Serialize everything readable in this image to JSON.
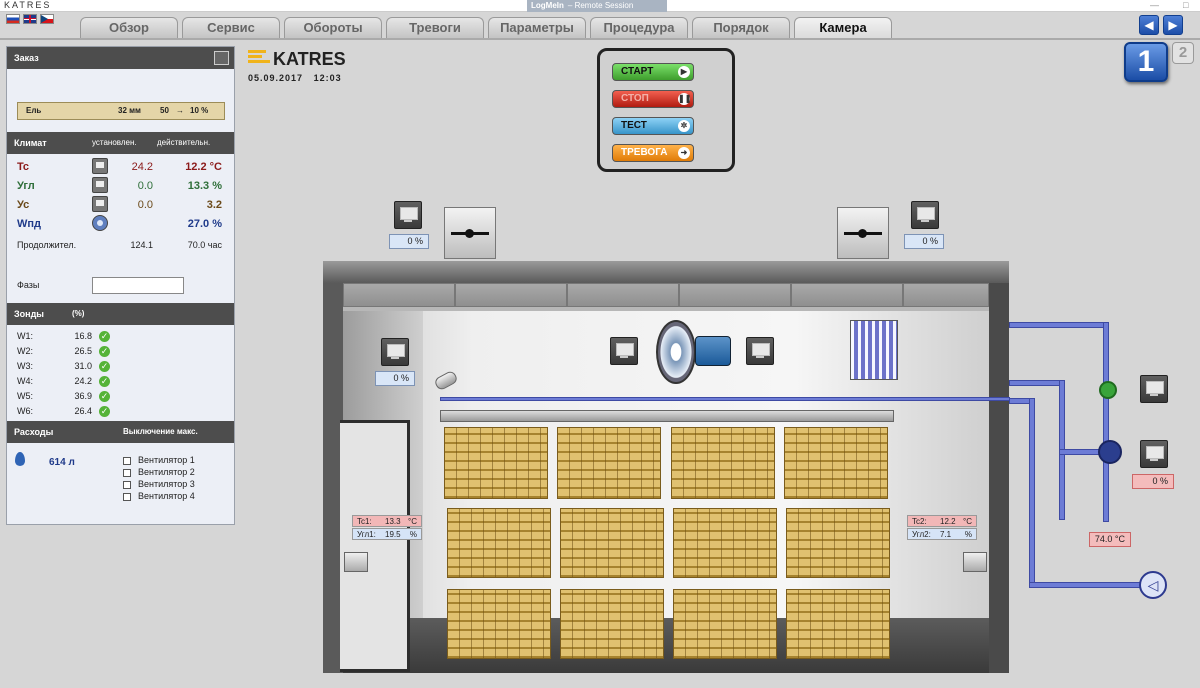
{
  "titlebar": {
    "app_name": "KATRES",
    "remote_app": "LogMeIn",
    "remote_sep": "–",
    "remote_session": "Remote Session"
  },
  "tabs": [
    "Обзор",
    "Сервис",
    "Обороты",
    "Тревоги",
    "Параметры",
    "Процедура",
    "Порядок",
    "Камера"
  ],
  "active_tab": "Камера",
  "nav": {
    "prev": "◀",
    "next": "▶",
    "camera_1": "1",
    "camera_2": "2"
  },
  "order": {
    "header": "Заказ",
    "wood": "Ель",
    "thickness": "32 мм",
    "moisture_from": "50",
    "moisture_to": "10 %"
  },
  "climate": {
    "header": "Климат",
    "col_set": "установлен.",
    "col_actual": "действительн.",
    "rows": [
      {
        "label": "Tc",
        "set": "24.2",
        "actual": "12.2 °C",
        "color": "#8b1a1a"
      },
      {
        "label": "Угл",
        "set": "0.0",
        "actual": "13.3 %",
        "color": "#2f6f3a"
      },
      {
        "label": "Ус",
        "set": "0.0",
        "actual": "3.2",
        "color": "#6b4a1a"
      },
      {
        "label": "Wпд",
        "set": "",
        "actual": "27.0 %",
        "color": "#1f3a8a"
      }
    ],
    "duration_label": "Продолжител.",
    "duration_set": "124.1",
    "duration_actual": "70.0 час",
    "phases_label": "Фазы"
  },
  "probes": {
    "header": "Зонды",
    "unit": "(%)",
    "items": [
      {
        "label": "W1:",
        "value": "16.8"
      },
      {
        "label": "W2:",
        "value": "26.5"
      },
      {
        "label": "W3:",
        "value": "31.0"
      },
      {
        "label": "W4:",
        "value": "24.2"
      },
      {
        "label": "W5:",
        "value": "36.9"
      },
      {
        "label": "W6:",
        "value": "26.4"
      }
    ]
  },
  "consumption": {
    "header": "Расходы",
    "max_off": "Выключение макс.",
    "water": "614 л",
    "fans": [
      "Вентилятор 1",
      "Вентилятор 2",
      "Вентилятор 3",
      "Вентилятор 4"
    ]
  },
  "logo": "KATRES",
  "date": "05.09.2017",
  "time": "12:03",
  "controls": {
    "start": "СТАРТ",
    "stop": "СТОП",
    "test": "ТЕСТ",
    "alarm": "ТРЕВОГА"
  },
  "values": {
    "vent_left": "0 %",
    "vent_right": "0 %",
    "nozzle": "0 %",
    "valve": "0 %",
    "water_temp": "74.0 °C"
  },
  "sensor1": {
    "t_label": "Tc1:",
    "t_value": "13.3",
    "t_unit": "°C",
    "h_label": "Угл1:",
    "h_value": "19.5",
    "h_unit": "%"
  },
  "sensor2": {
    "t_label": "Tc2:",
    "t_value": "12.2",
    "t_unit": "°C",
    "h_label": "Угл2:",
    "h_value": "7.1",
    "h_unit": "%"
  }
}
